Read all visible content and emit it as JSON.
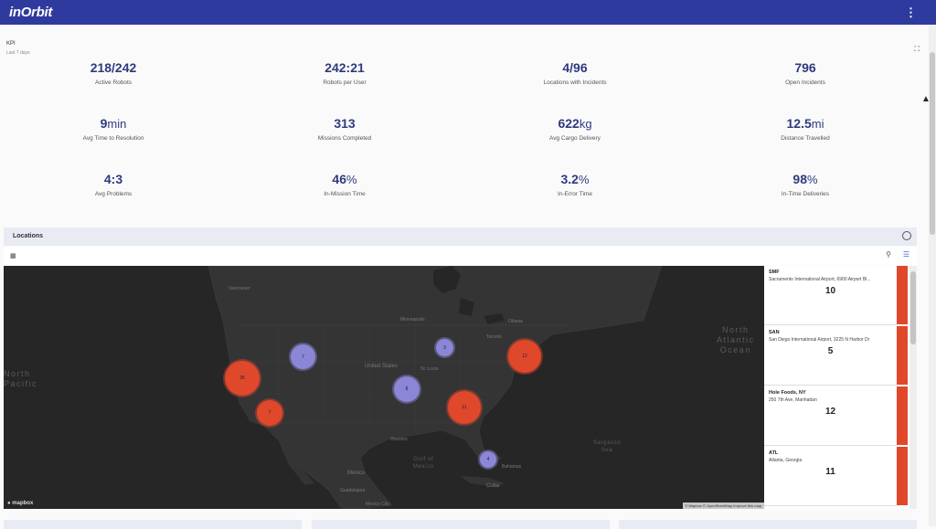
{
  "app": {
    "logo": "inOrbit"
  },
  "header": {
    "menu_icon": "more-vert-icon"
  },
  "kpi": {
    "title": "KPI",
    "subtitle": "Last 7 days",
    "items": [
      {
        "value": "218/242",
        "unit": "",
        "label": "Active Robots"
      },
      {
        "value": "242:21",
        "unit": "",
        "label": "Robots per User"
      },
      {
        "value": "4/96",
        "unit": "",
        "label": "Locations with Incidents"
      },
      {
        "value": "796",
        "unit": "",
        "label": "Open Incidents"
      },
      {
        "value": "9",
        "unit": "min",
        "label": "Avg Time to Resolution"
      },
      {
        "value": "313",
        "unit": "",
        "label": "Missions Completed"
      },
      {
        "value": "622",
        "unit": "kg",
        "label": "Avg Cargo Delivery"
      },
      {
        "value": "12.5",
        "unit": "mi",
        "label": "Distance Travelled"
      },
      {
        "value": "4:3",
        "unit": "",
        "label": "Avg Problems"
      },
      {
        "value": "46",
        "unit": "%",
        "label": "In-Mission Time"
      },
      {
        "value": "3.2",
        "unit": "%",
        "label": "In-Error Time"
      },
      {
        "value": "98",
        "unit": "%",
        "label": "In-Time Deliveries"
      }
    ]
  },
  "locations": {
    "title": "Locations",
    "map": {
      "clusters": [
        {
          "count": "35",
          "color": "red"
        },
        {
          "count": "7",
          "color": "red"
        },
        {
          "count": "7",
          "color": "purple"
        },
        {
          "count": "8",
          "color": "purple"
        },
        {
          "count": "3",
          "color": "purple"
        },
        {
          "count": "11",
          "color": "red"
        },
        {
          "count": "12",
          "color": "red"
        },
        {
          "count": "4",
          "color": "purple"
        }
      ],
      "labels": {
        "vancouver": "Vancouver",
        "ottawa": "Ottawa",
        "toronto": "Toronto",
        "minneapolis": "Minneapolis",
        "st_louis": "St. Louis",
        "united_states": "United States",
        "houston": "Houston",
        "mexico": "Mexico",
        "guadalajara": "Guadalajara",
        "mexico_city": "Mexico City",
        "cuba": "Cuba",
        "bahamas": "Bahamas",
        "gulf": "Gulf of\nMexico",
        "sargasso": "Sargasso\nSea",
        "atlantic": "North\nAtlantic\nOcean",
        "pacific": "North\nPacific"
      },
      "mapbox_logo": "mapbox",
      "attribution": "© Mapbox © OpenStreetMap  Improve this map"
    },
    "side_list": [
      {
        "code": "SMF",
        "address": "Sacramento International Airport, 6900 Airport Bl...",
        "count": "10"
      },
      {
        "code": "SAN",
        "address": "San Diego International Airport, 3225 N Harbor Dr",
        "count": "5"
      },
      {
        "code": "Hole Foods, NY",
        "address": "250 7th Ave, Manhattan",
        "count": "12"
      },
      {
        "code": "ATL",
        "address": "Atlanta, Georgia",
        "count": "11"
      }
    ]
  },
  "colors": {
    "header": "#2f3a9e",
    "accent": "#2f3a7e",
    "alert": "#e0482b",
    "cluster_purple": "#8b86d6"
  }
}
